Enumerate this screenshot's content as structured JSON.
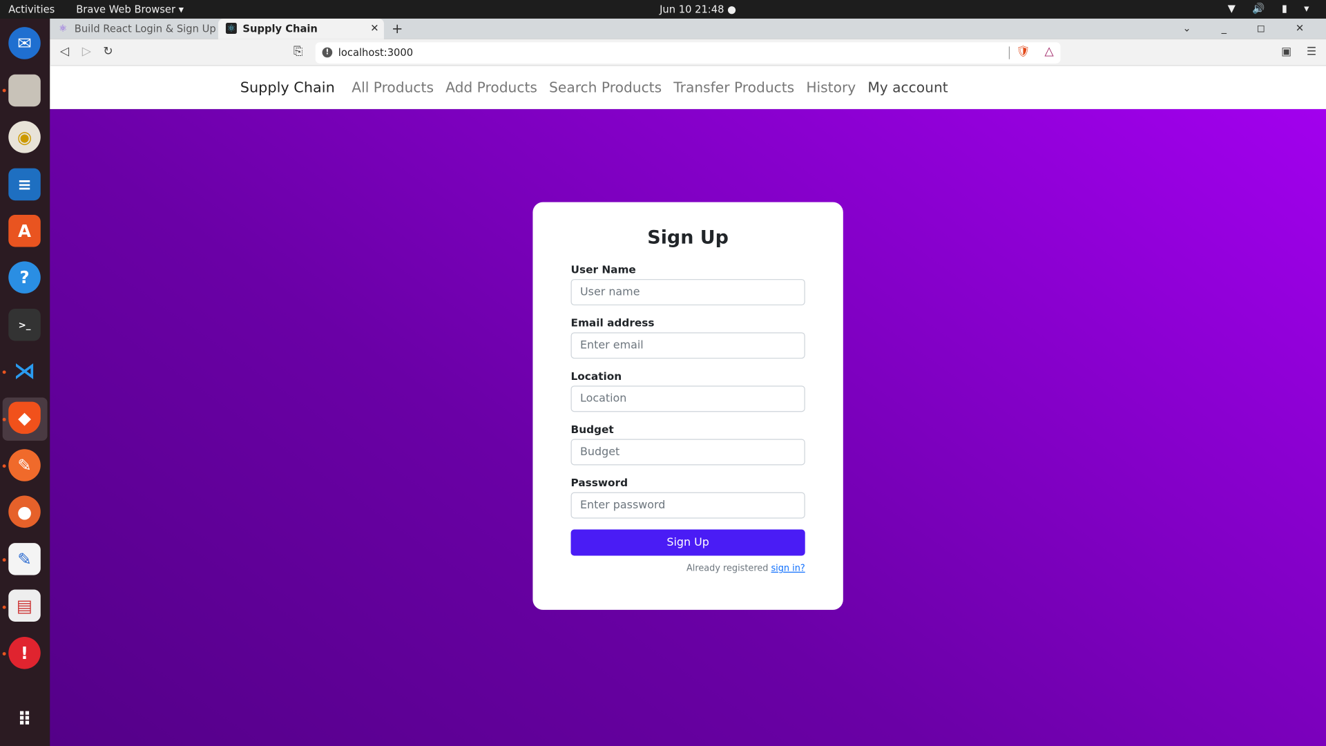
{
  "system": {
    "activities": "Activities",
    "app_menu": "Brave Web Browser ▾",
    "clock": "Jun 10  21:48  ●",
    "tray": "▼ 🔊 ▮ ▾"
  },
  "dock": [
    "thunderbird-icon",
    "files-icon",
    "rhythmbox-icon",
    "writer-icon",
    "software-icon",
    "help-icon",
    "terminal-icon",
    "vscode-icon",
    "brave-icon",
    "postman-icon",
    "firefox-icon",
    "text-editor-icon",
    "reader-icon",
    "update-icon",
    "app-grid-icon"
  ],
  "browser": {
    "tabs": [
      {
        "title": "Build React Login & Sign Up UI"
      },
      {
        "title": "Supply Chain",
        "close": "✕"
      }
    ],
    "new_tab": "+",
    "url": "localhost:3000",
    "window_controls": "⌄ _ ◻ ✕"
  },
  "navbar": {
    "brand": "Supply Chain",
    "links": [
      "All Products",
      "Add Products",
      "Search Products",
      "Transfer Products",
      "History",
      "My account"
    ]
  },
  "form": {
    "title": "Sign Up",
    "fields": [
      {
        "label": "User Name",
        "placeholder": "User name"
      },
      {
        "label": "Email address",
        "placeholder": "Enter email"
      },
      {
        "label": "Location",
        "placeholder": "Location"
      },
      {
        "label": "Budget",
        "placeholder": "Budget"
      },
      {
        "label": "Password",
        "placeholder": "Enter password"
      }
    ],
    "submit": "Sign Up",
    "footer_text": "Already registered ",
    "footer_link": "sign in?"
  },
  "colors": {
    "button": "#4a1cf5",
    "gradient_start": "#540088",
    "gradient_end": "#a200ee"
  }
}
